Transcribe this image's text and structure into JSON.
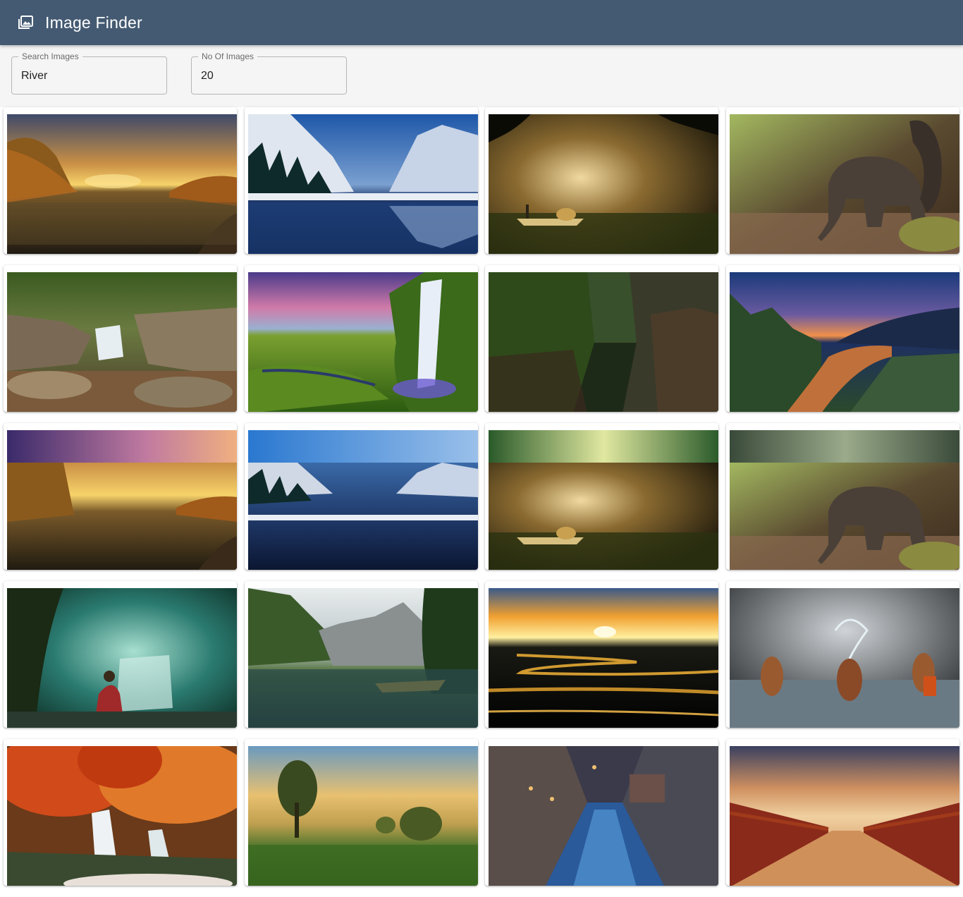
{
  "app": {
    "title": "Image Finder",
    "icon": "photo-library-icon",
    "brand_color": "#445a72"
  },
  "search": {
    "label": "Search Images",
    "value": "River"
  },
  "count": {
    "label": "No Of Images",
    "value": "20"
  },
  "images": [
    {
      "subject": "river-sunset-autumn"
    },
    {
      "subject": "yosemite-mountain-lake"
    },
    {
      "subject": "misty-boat-fisherman"
    },
    {
      "subject": "elephant-forest-stream"
    },
    {
      "subject": "forest-rock-waterfall"
    },
    {
      "subject": "seljalandsfoss-waterfall"
    },
    {
      "subject": "green-canyon"
    },
    {
      "subject": "river-valley-sunset"
    },
    {
      "subject": "river-sunset-autumn"
    },
    {
      "subject": "yosemite-mountain-lake"
    },
    {
      "subject": "misty-boat-fisherman"
    },
    {
      "subject": "elephant-forest-stream"
    },
    {
      "subject": "girl-forest-waterfall"
    },
    {
      "subject": "alpine-lake-boat"
    },
    {
      "subject": "winding-river-sunset"
    },
    {
      "subject": "children-splashing-river"
    },
    {
      "subject": "autumn-maple-waterfall"
    },
    {
      "subject": "misty-meadow-tree"
    },
    {
      "subject": "rainy-alley-street"
    },
    {
      "subject": "wooden-bridge-sunset"
    }
  ]
}
